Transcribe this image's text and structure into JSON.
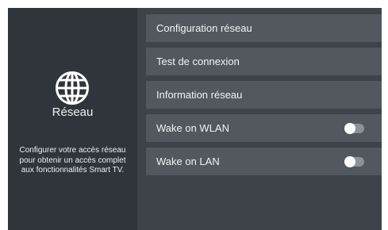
{
  "panel": {
    "icon": "globe-icon",
    "title": "Réseau",
    "description_lines": [
      "Configurer votre accès réseau",
      "pour obtenir un accès complet",
      "aux fonctionnalités Smart TV."
    ]
  },
  "menu": {
    "items": [
      {
        "label": "Configuration réseau"
      },
      {
        "label": "Test de connexion"
      },
      {
        "label": "Information réseau"
      },
      {
        "label": "Wake on WLAN",
        "toggle": "off"
      },
      {
        "label": "Wake on LAN",
        "toggle": "off"
      }
    ]
  },
  "colors": {
    "screen_bg": "#3d4349",
    "left_panel_bg": "#2f353a",
    "menu_item_bg": "#52585e",
    "toggle_track": "#8d9296",
    "text": "#f2f4f5"
  }
}
